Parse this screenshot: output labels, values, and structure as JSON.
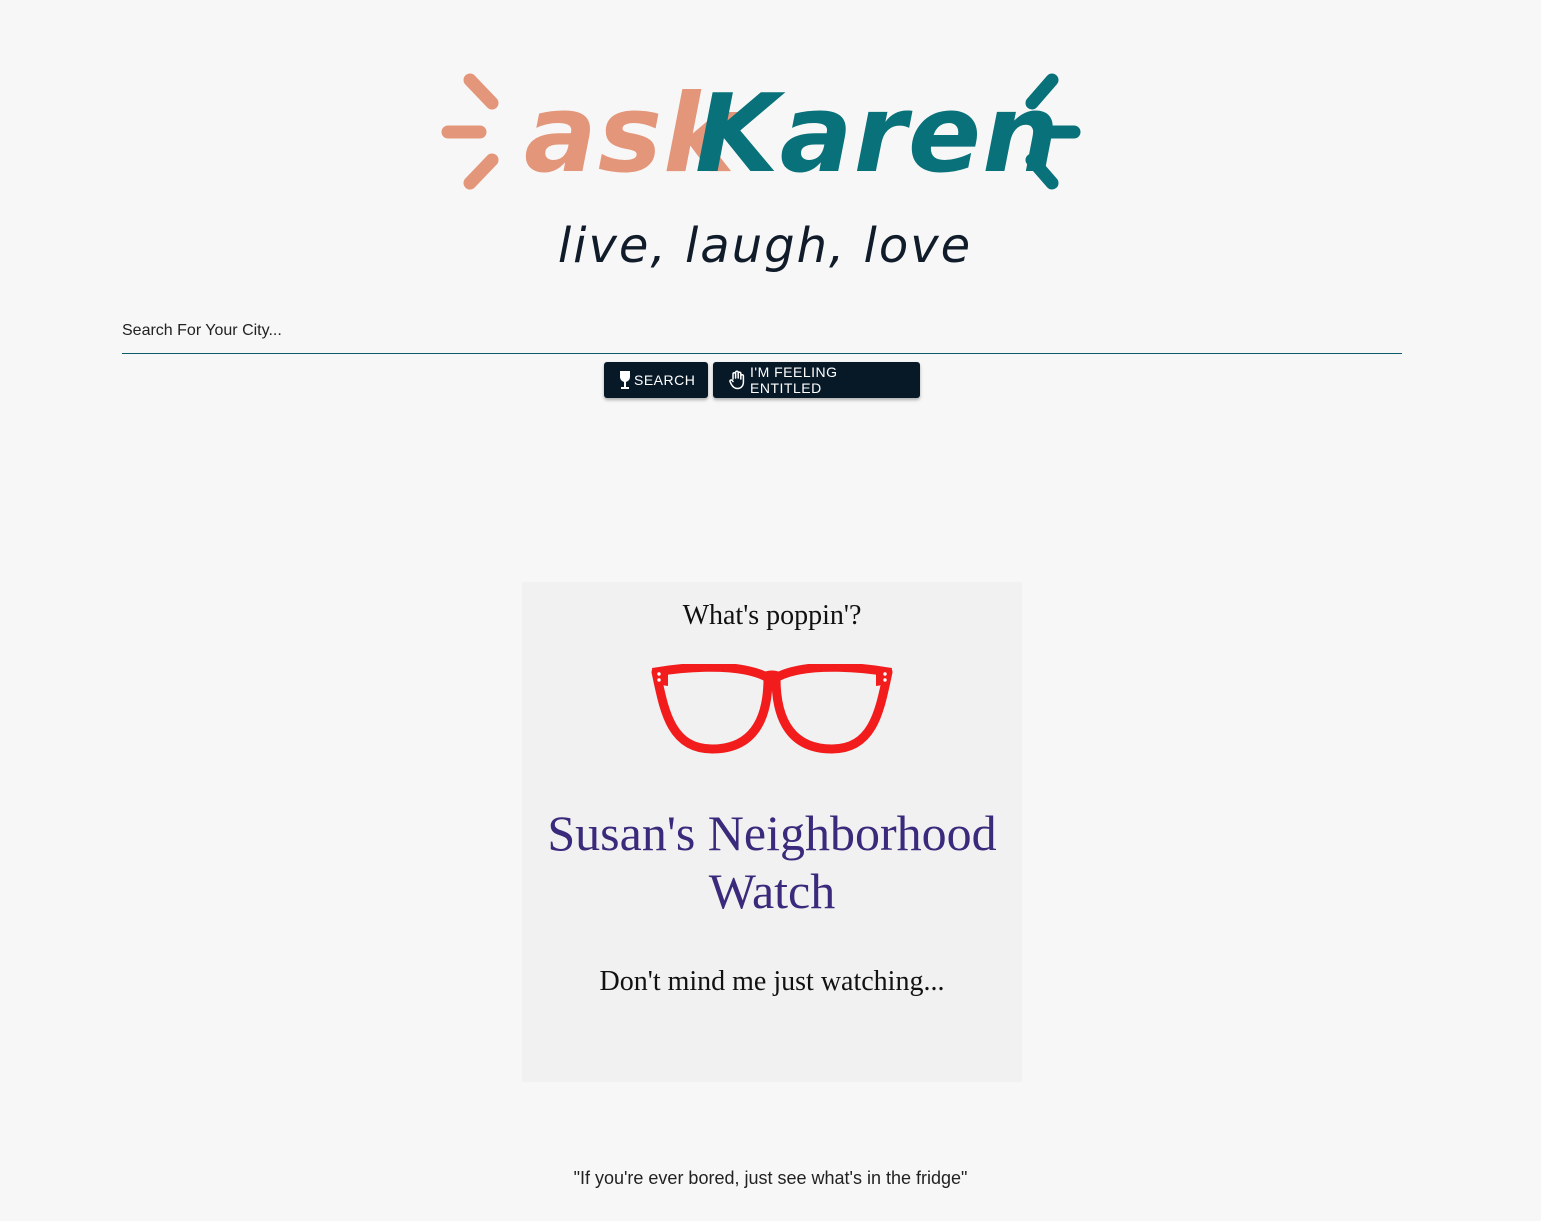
{
  "logo": {
    "ask": "ask",
    "karen": "Karen",
    "tagline": "live, laugh, love",
    "colors": {
      "ask": "#e4967a",
      "karen": "#08717a"
    }
  },
  "search": {
    "placeholder": "Search For Your City...",
    "value": ""
  },
  "buttons": {
    "search_label": "SEARCH",
    "search_icon": "wine-glass-icon",
    "entitled_label": "I'M FEELING ENTITLED",
    "entitled_icon": "raised-hand-icon"
  },
  "card": {
    "question": "What's poppin'?",
    "icon": "glasses-icon",
    "title": "Susan's Neighborhood Watch",
    "subtitle": "Don't mind me just watching...",
    "colors": {
      "glasses": "#f21c1c",
      "title": "#3b2a7c"
    }
  },
  "footer": {
    "quote": "\"If you're ever bored, just see what's in the fridge\""
  }
}
